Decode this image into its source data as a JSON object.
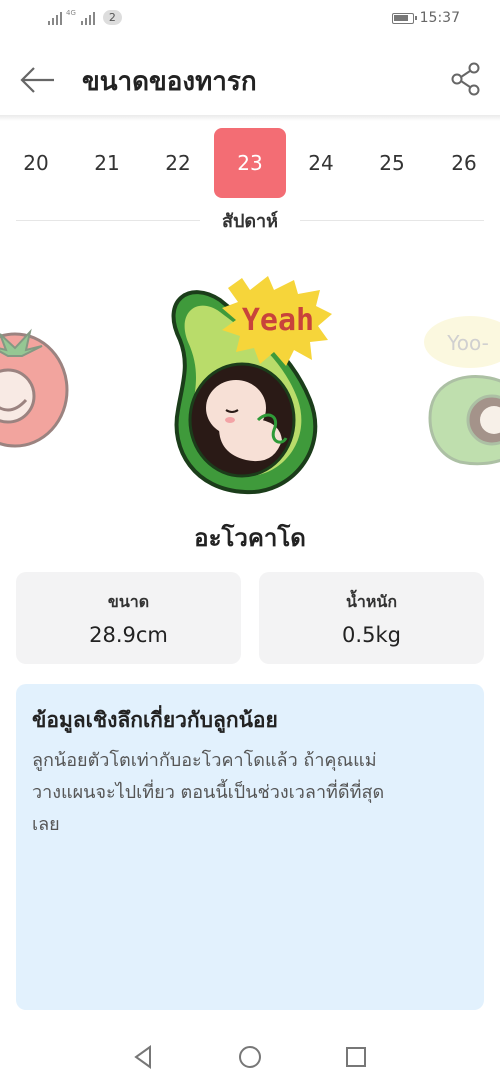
{
  "status_bar": {
    "signal_label": "4G",
    "sim_badge": "2",
    "time": "15:37"
  },
  "header": {
    "title": "ขนาดของทารก",
    "back_icon": "arrow-left-icon",
    "share_icon": "share-icon"
  },
  "weeks": {
    "items": [
      "20",
      "21",
      "22",
      "23",
      "24",
      "25",
      "26"
    ],
    "selected": "23",
    "label": "สัปดาห์"
  },
  "illustration": {
    "bubble_text": "Yeah",
    "right_bubble_text": "Yoo-",
    "colors": {
      "avocado_skin": "#3f9a3b",
      "avocado_flesh": "#b9dc6a",
      "bubble": "#f6d53a",
      "accent": "#f36d74"
    }
  },
  "fruit": {
    "name": "อะโวคาโด"
  },
  "stats": {
    "size_label": "ขนาด",
    "size_value": "28.9cm",
    "weight_label": "น้ำหนัก",
    "weight_value": "0.5kg"
  },
  "info": {
    "title": "ข้อมูลเชิงลึกเกี่ยวกับลูกน้อย",
    "lines": [
      "ลูกน้อยตัวโตเท่ากับอะโวคาโดแล้ว ถ้าคุณแม่",
      "วางแผนจะไปเที่ยว ตอนนี้เป็นช่วงเวลาที่ดีที่สุด",
      "เลย"
    ],
    "background": "#e2f1fd"
  },
  "navbar": {
    "back_icon": "triangle-back-icon",
    "home_icon": "circle-home-icon",
    "recents_icon": "square-recents-icon"
  }
}
